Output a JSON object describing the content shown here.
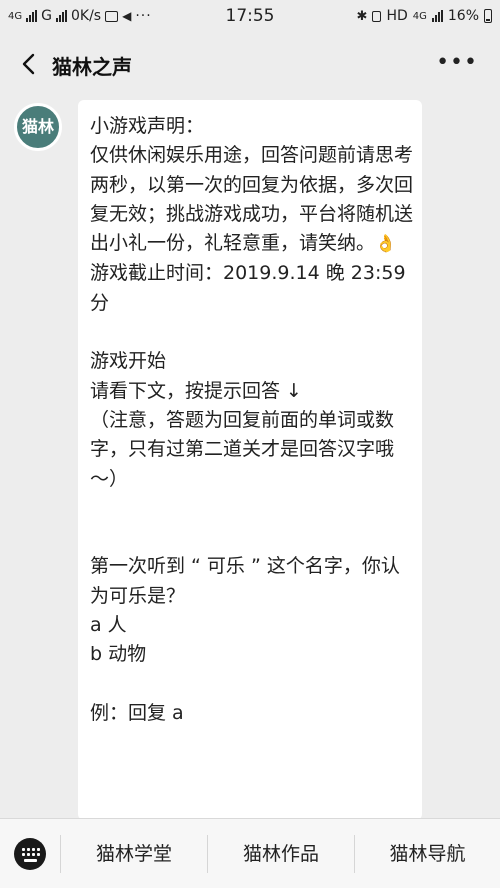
{
  "status_bar": {
    "net1": "4G",
    "net2": "G",
    "speed": "0K/s",
    "time": "17:55",
    "hd": "HD",
    "net3": "4G",
    "battery": "16%"
  },
  "header": {
    "title": "猫林之声",
    "more": "•••"
  },
  "avatar": {
    "text": "猫林"
  },
  "message": {
    "text_before": "小游戏声明：\n仅供休闲娱乐用途，回答问题前请思考两秒，以第一次的回复为依据，多次回复无效；挑战游戏成功，平台将随机送出小礼一份，礼轻意重，请笑纳。",
    "emoji": "👌",
    "text_after": "\n游戏截止时间：2019.9.14 晚 23:59 分\n\n游戏开始\n请看下文，按提示回答 ↓\n（注意，答题为回复前面的单词或数字，只有过第二道关才是回答汉字哦～）\n\n\n第一次听到 “ 可乐 ” 这个名字，你认为可乐是？\na 人\nb 动物\n\n例：回复 a"
  },
  "bottom_menu": {
    "items": [
      "猫林学堂",
      "猫林作品",
      "猫林导航"
    ]
  }
}
